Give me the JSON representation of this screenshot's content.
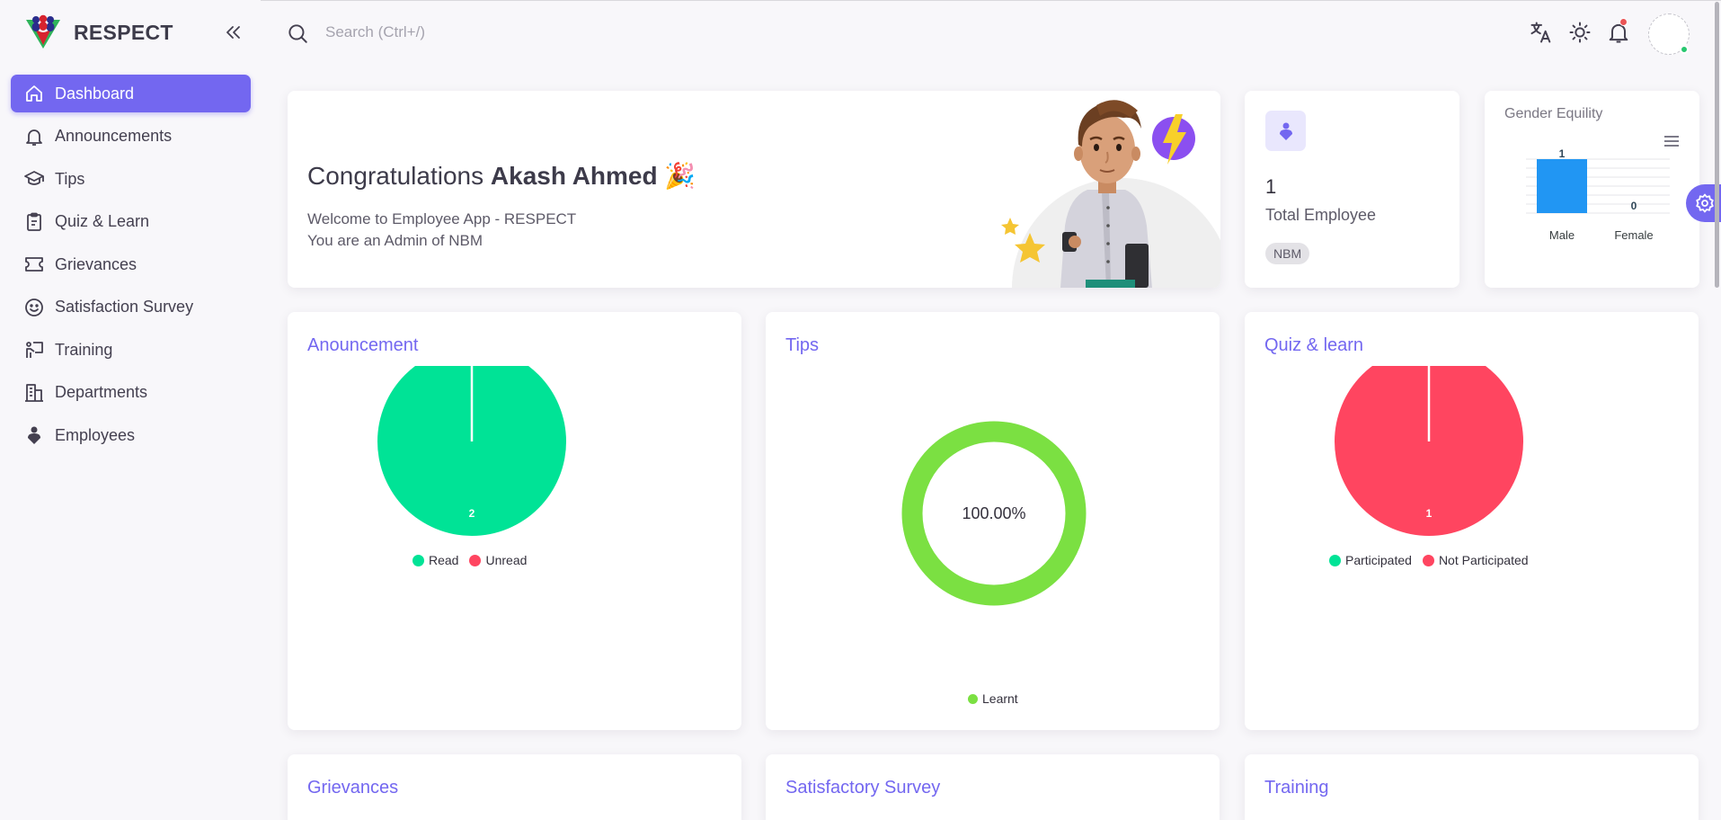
{
  "brand": {
    "name": "RESPECT"
  },
  "search": {
    "placeholder": "Search (Ctrl+/)"
  },
  "sidebar": {
    "items": [
      {
        "label": "Dashboard",
        "icon": "home-icon",
        "active": true
      },
      {
        "label": "Announcements",
        "icon": "bell-icon"
      },
      {
        "label": "Tips",
        "icon": "graduation-cap-icon"
      },
      {
        "label": "Quiz & Learn",
        "icon": "clipboard-icon"
      },
      {
        "label": "Grievances",
        "icon": "ticket-icon"
      },
      {
        "label": "Satisfaction Survey",
        "icon": "smile-icon"
      },
      {
        "label": "Training",
        "icon": "presentation-icon"
      },
      {
        "label": "Departments",
        "icon": "building-icon"
      },
      {
        "label": "Employees",
        "icon": "user-icon"
      }
    ]
  },
  "header_icons": [
    "translate-icon",
    "sun-icon",
    "bell-icon",
    "avatar"
  ],
  "welcome": {
    "greeting": "Congratulations",
    "name": "Akash Ahmed",
    "emoji": "🎉",
    "line1": "Welcome to Employee App - RESPECT",
    "line2": "You are an Admin of NBM"
  },
  "total_employee": {
    "count": "1",
    "label": "Total Employee",
    "badge": "NBM"
  },
  "colors": {
    "accent": "#7367f0",
    "read": "#00e396",
    "unread": "#ff4560",
    "learnt": "#7be042",
    "bar": "#2196f3"
  },
  "charts": {
    "gender": {
      "title": "Gender Equility",
      "chart_data": {
        "type": "bar",
        "categories": [
          "Male",
          "Female"
        ],
        "values": [
          1,
          0
        ],
        "ylim": [
          0,
          1
        ]
      }
    },
    "announcement": {
      "title": "Anouncement",
      "chart_data": {
        "type": "pie",
        "labels": [
          "Read",
          "Unread"
        ],
        "values": [
          2,
          0
        ],
        "data_label": "2"
      }
    },
    "tips": {
      "title": "Tips",
      "chart_data": {
        "type": "pie",
        "labels": [
          "Learnt"
        ],
        "values": [
          100
        ],
        "center_label": "100.00%"
      }
    },
    "quiz": {
      "title": "Quiz & learn",
      "chart_data": {
        "type": "pie",
        "labels": [
          "Participated",
          "Not Participated"
        ],
        "values": [
          0,
          1
        ],
        "data_label": "1"
      }
    }
  },
  "bottom_cards": {
    "grievances": "Grievances",
    "survey": "Satisfactory Survey",
    "training": "Training"
  }
}
